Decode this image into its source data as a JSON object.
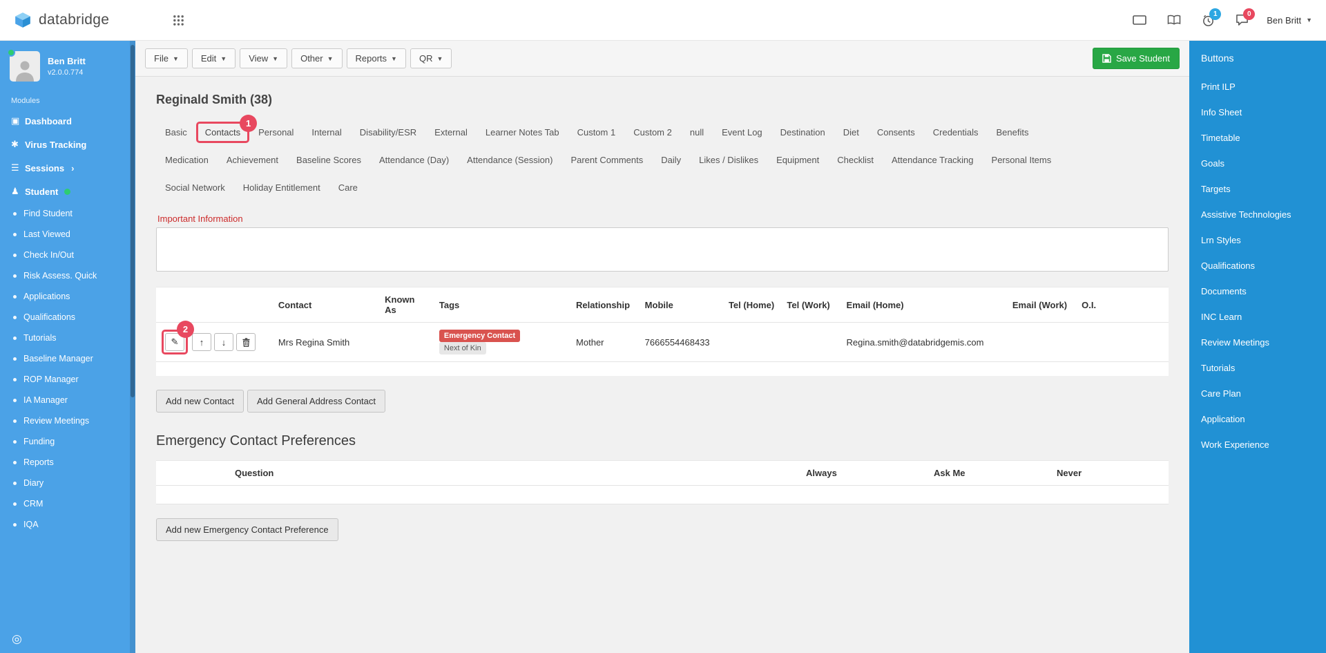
{
  "topbar": {
    "brand": "databridge",
    "clock_badge": "1",
    "chat_badge": "0",
    "user_menu": "Ben Britt"
  },
  "left_sidebar": {
    "user": {
      "name": "Ben Britt",
      "version": "v2.0.0.774"
    },
    "section_label": "Modules",
    "modules": [
      {
        "label": "Dashboard",
        "icon": "dashboard-icon"
      },
      {
        "label": "Virus Tracking",
        "icon": "virus-icon"
      },
      {
        "label": "Sessions",
        "icon": "sessions-icon",
        "chevron": true
      },
      {
        "label": "Student",
        "icon": "student-icon",
        "dot": true
      }
    ],
    "sub_items": [
      "Find Student",
      "Last Viewed",
      "Check In/Out",
      "Risk Assess. Quick",
      "Applications",
      "Qualifications",
      "Tutorials",
      "Baseline Manager",
      "ROP Manager",
      "IA Manager",
      "Review Meetings",
      "Funding",
      "Reports",
      "Diary",
      "CRM",
      "IQA"
    ]
  },
  "menubar": {
    "menus": [
      "File",
      "Edit",
      "View",
      "Other",
      "Reports",
      "QR"
    ],
    "save_button": "Save Student"
  },
  "page": {
    "title": "Reginald Smith (38)",
    "tabs_row1": [
      {
        "label": "Basic"
      },
      {
        "label": "Contacts",
        "class": "annotated",
        "badge": "1"
      },
      {
        "label": "Personal"
      },
      {
        "label": "Internal"
      },
      {
        "label": "Disability/ESR"
      },
      {
        "label": "External"
      },
      {
        "label": "Learner Notes Tab"
      },
      {
        "label": "Custom 1"
      },
      {
        "label": "Custom 2"
      },
      {
        "label": "null"
      },
      {
        "label": "Event Log"
      },
      {
        "label": "Destination"
      },
      {
        "label": "Diet"
      },
      {
        "label": "Consents"
      },
      {
        "label": "Credentials"
      },
      {
        "label": "Benefits"
      }
    ],
    "tabs_row2": [
      "Medication",
      "Achievement",
      "Baseline Scores",
      "Attendance (Day)",
      "Attendance (Session)",
      "Parent Comments",
      "Daily",
      "Likes / Dislikes",
      "Equipment",
      "Checklist",
      "Attendance Tracking",
      "Personal Items"
    ],
    "tabs_row3": [
      "Social Network",
      "Holiday Entitlement",
      "Care"
    ],
    "important_info_label": "Important Information",
    "contacts_table": {
      "headers": [
        "Contact",
        "Known As",
        "Tags",
        "Relationship",
        "Mobile",
        "Tel (Home)",
        "Tel (Work)",
        "Email (Home)",
        "Email (Work)",
        "O.I."
      ],
      "annotation_badge": "2",
      "row": {
        "contact": "Mrs Regina Smith",
        "known_as": "",
        "tags": [
          {
            "label": "Emergency Contact",
            "style": "danger"
          },
          {
            "label": "Next of Kin",
            "style": "default"
          }
        ],
        "relationship": "Mother",
        "mobile": "7666554468433",
        "tel_home": "",
        "tel_work": "",
        "email_home": "Regina.smith@databridgemis.com",
        "email_work": "",
        "oi": ""
      }
    },
    "buttons": {
      "add_contact": "Add new Contact",
      "add_general": "Add General Address Contact",
      "add_pref": "Add new Emergency Contact Preference"
    },
    "ecp": {
      "heading": "Emergency Contact Preferences",
      "headers": [
        "Question",
        "Always",
        "Ask Me",
        "Never"
      ]
    }
  },
  "right_sidebar": {
    "title": "Buttons",
    "items": [
      "Print ILP",
      "Info Sheet",
      "Timetable",
      "Goals",
      "Targets",
      "Assistive Technologies",
      "Lrn Styles",
      "Qualifications",
      "Documents",
      "INC Learn",
      "Review Meetings",
      "Tutorials",
      "Care Plan",
      "Application",
      "Work Experience"
    ]
  },
  "colors": {
    "sidebar_left": "#4ba2e7",
    "sidebar_right": "#2191d4",
    "annotation": "#e8485f",
    "save_green": "#28a745",
    "danger_tag": "#d9534f"
  }
}
